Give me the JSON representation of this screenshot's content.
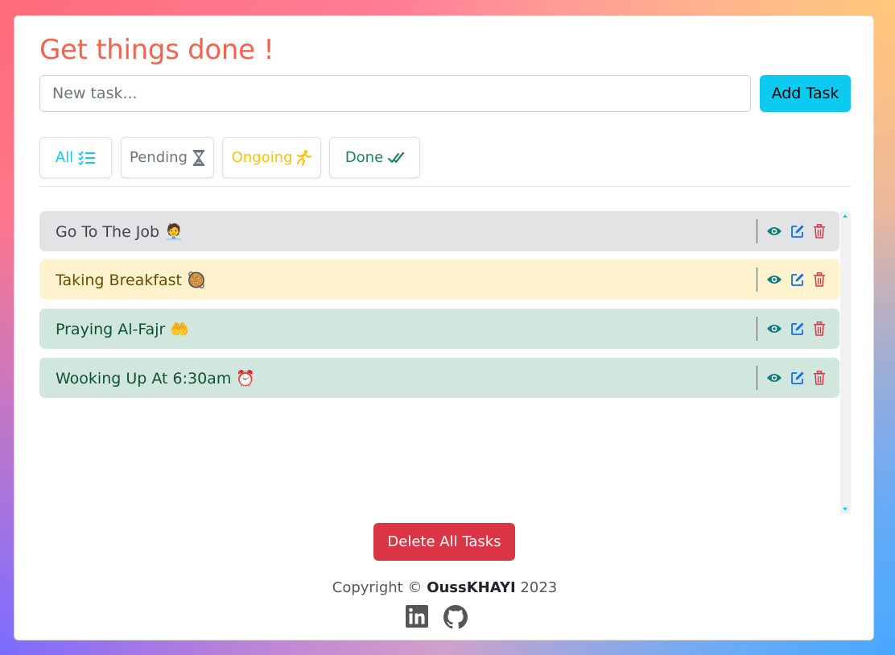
{
  "header": {
    "title": "Get things done !"
  },
  "new_task": {
    "placeholder": "New task...",
    "value": "",
    "add_label": "Add Task"
  },
  "filters": [
    {
      "label": "All",
      "icon": "list-check-icon",
      "color": "#0dcaf0"
    },
    {
      "label": "Pending",
      "icon": "hourglass-icon",
      "color": "#6c757d"
    },
    {
      "label": "Ongoing",
      "icon": "running-person-icon",
      "color": "#ffc107"
    },
    {
      "label": "Done",
      "icon": "double-check-icon",
      "color": "#198754"
    }
  ],
  "tasks": [
    {
      "text": "Go To The Job 🧑‍💼",
      "status": "pending"
    },
    {
      "text": "Taking Breakfast 🥘",
      "status": "ongoing"
    },
    {
      "text": "Praying Al-Fajr 🤲",
      "status": "done"
    },
    {
      "text": "Wooking Up At 6:30am ⏰",
      "status": "done"
    }
  ],
  "actions": {
    "delete_all_label": "Delete All Tasks"
  },
  "footer": {
    "copyright_prefix": "Copyright ©",
    "author": "OussKHAYI",
    "year": "2023",
    "links": [
      "linkedin-icon",
      "github-icon"
    ]
  },
  "colors": {
    "title": "#f26451",
    "add_button": "#0dcaf0",
    "delete_all_button": "#dc3545",
    "pending_row": "#e2e3e5",
    "ongoing_row": "#fff3cd",
    "done_row": "#d1e7dd",
    "view_icon": "#0f7d7a",
    "edit_icon": "#0d6efd",
    "delete_icon": "#dc3545"
  }
}
